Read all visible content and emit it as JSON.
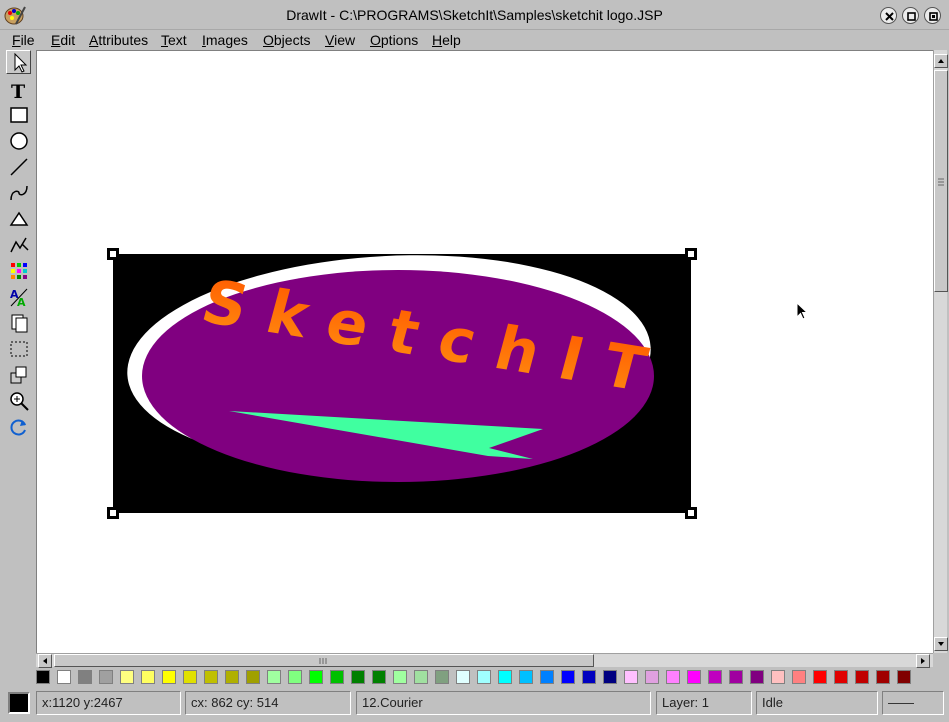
{
  "window": {
    "title": "DrawIt - C:\\PROGRAMS\\SketchIt\\Samples\\sketchit logo.JSP",
    "icons": [
      "close-icon",
      "restore-icon",
      "minimize-icon"
    ]
  },
  "menu": [
    {
      "label": "File"
    },
    {
      "label": "Edit"
    },
    {
      "label": "Attributes"
    },
    {
      "label": "Text"
    },
    {
      "label": "Images"
    },
    {
      "label": "Objects"
    },
    {
      "label": "View"
    },
    {
      "label": "Options"
    },
    {
      "label": "Help"
    }
  ],
  "tools": [
    {
      "name": "select-tool",
      "icon": "arrow-pointer-icon",
      "active": true
    },
    {
      "name": "text-tool",
      "icon": "text-T-icon"
    },
    {
      "name": "rectangle-tool",
      "icon": "rectangle-icon"
    },
    {
      "name": "ellipse-tool",
      "icon": "circle-icon"
    },
    {
      "name": "line-tool",
      "icon": "line-icon"
    },
    {
      "name": "curve-tool",
      "icon": "curve-icon"
    },
    {
      "name": "polygon-tool",
      "icon": "polygon-icon"
    },
    {
      "name": "freehand-tool",
      "icon": "freehand-icon"
    },
    {
      "name": "color-grid-tool",
      "icon": "palette-grid-icon"
    },
    {
      "name": "text-attributes-tool",
      "icon": "text-style-icon"
    },
    {
      "name": "copy-page-tool",
      "icon": "pages-icon"
    },
    {
      "name": "selection-region-tool",
      "icon": "dashed-region-icon"
    },
    {
      "name": "group-objects-tool",
      "icon": "stacked-objects-icon"
    },
    {
      "name": "zoom-tool",
      "icon": "magnifier-icon"
    },
    {
      "name": "rotate-tool",
      "icon": "rotate-icon"
    }
  ],
  "drawing": {
    "logo_text": "SketchIT",
    "colors": {
      "background": "#000000",
      "ellipse": "#800080",
      "highlight": "#ffffff",
      "text_top": "#ff5a00",
      "text_bottom": "#ff8c10",
      "swoosh": "#40ffa0"
    }
  },
  "palette": [
    "#000000",
    "#ffffff",
    "#808080",
    "#a0a0a0",
    "#ffff80",
    "#ffff60",
    "#ffff00",
    "#e0e000",
    "#c0c000",
    "#b0b000",
    "#a0a000",
    "#a0ffa0",
    "#80ff80",
    "#00ff00",
    "#00c000",
    "#008000",
    "#008000",
    "#a0ffa0",
    "#a0e0a0",
    "#80a080",
    "#e0ffff",
    "#a0ffff",
    "#00ffff",
    "#00c0ff",
    "#0080ff",
    "#0000ff",
    "#0000c0",
    "#000080",
    "#ffc0ff",
    "#e0a0e0",
    "#ff80ff",
    "#ff00ff",
    "#c000c0",
    "#a000a0",
    "#800080",
    "#ffc0c0",
    "#ff8080",
    "#ff0000",
    "#e00000",
    "#c00000",
    "#a00000",
    "#800000"
  ],
  "status": {
    "current_color": "#000000",
    "coords": "x:1120 y:2467",
    "size": "cx: 862 cy: 514",
    "font": "12.Courier",
    "layer": "Layer: 1",
    "state": "Idle",
    "extra": "——"
  }
}
